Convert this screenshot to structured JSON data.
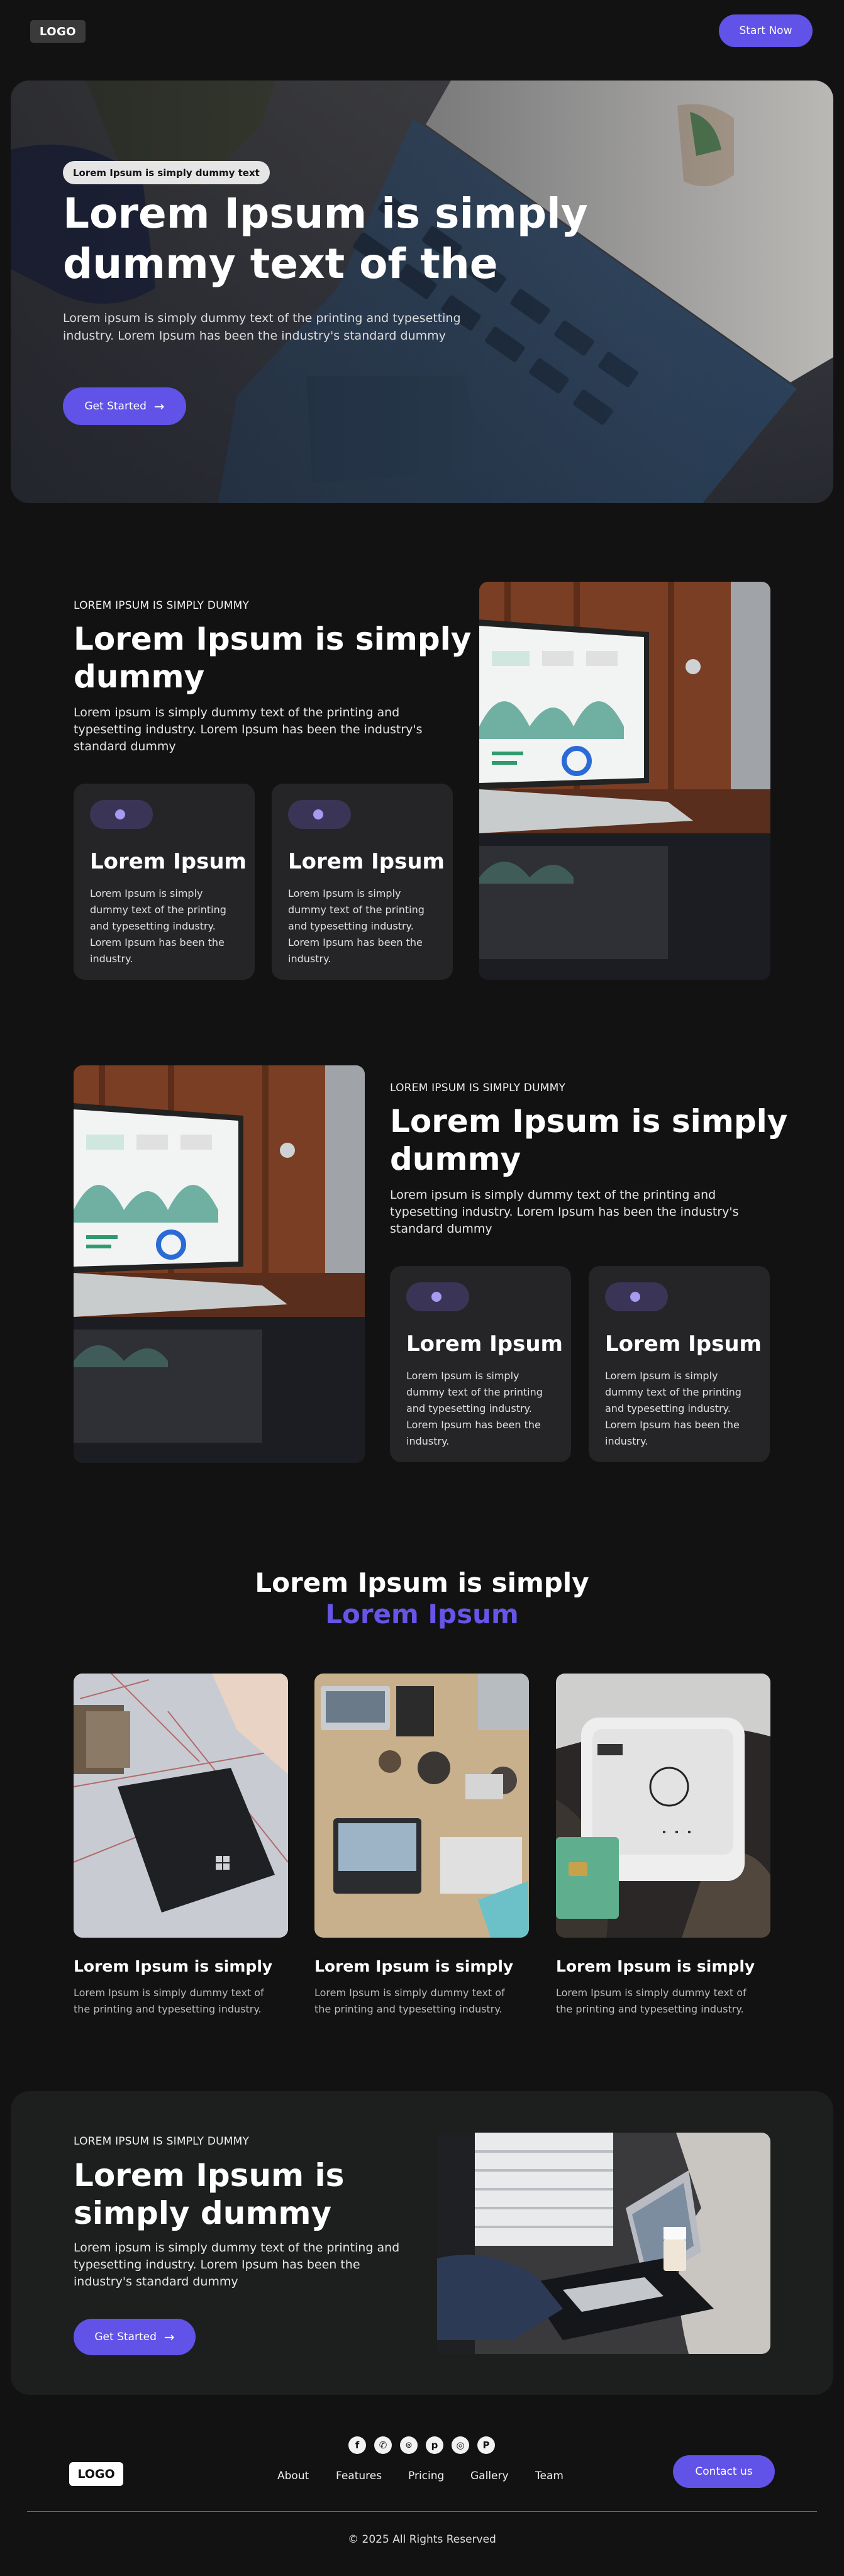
{
  "header": {
    "logo": "LOGO",
    "start_now": "Start Now"
  },
  "hero": {
    "badge": "Lorem Ipsum is simply dummy text",
    "title": "Lorem Ipsum is simply dummy text of the",
    "text": "Lorem ipsum is simply dummy text of the printing and typesetting industry. Lorem Ipsum has been the industry's standard dummy",
    "button": "Get Started",
    "arrow": "→"
  },
  "section1": {
    "eyebrow": "LOREM IPSUM IS SIMPLY DUMMY",
    "title": "Lorem Ipsum is simply dummy",
    "text": "Lorem ipsum is simply dummy text of the printing and typesetting industry. Lorem Ipsum has been the industry's standard dummy",
    "cards": [
      {
        "title": "Lorem Ipsum",
        "text": "Lorem Ipsum is simply dummy text of the printing and typesetting industry. Lorem Ipsum has been the industry."
      },
      {
        "title": "Lorem Ipsum",
        "text": "Lorem Ipsum is simply dummy text of the printing and typesetting industry. Lorem Ipsum has been the industry."
      }
    ]
  },
  "section2": {
    "eyebrow": "LOREM IPSUM IS SIMPLY DUMMY",
    "title": "Lorem Ipsum is simply dummy",
    "text": "Lorem ipsum is simply dummy text of the printing and typesetting industry. Lorem Ipsum has been the industry's standard dummy",
    "cards": [
      {
        "title": "Lorem Ipsum",
        "text": "Lorem Ipsum is simply dummy text of the printing and typesetting industry. Lorem Ipsum has been the industry."
      },
      {
        "title": "Lorem Ipsum",
        "text": "Lorem Ipsum is simply dummy text of the printing and typesetting industry. Lorem Ipsum has been the industry."
      }
    ]
  },
  "gallery": {
    "title_line1": "Lorem Ipsum is simply",
    "title_line2": "Lorem Ipsum",
    "items": [
      {
        "title": "Lorem Ipsum is simply",
        "text": "Lorem Ipsum is simply dummy text of the printing and typesetting industry."
      },
      {
        "title": "Lorem Ipsum is simply",
        "text": "Lorem Ipsum is simply dummy text of the printing and typesetting industry."
      },
      {
        "title": "Lorem Ipsum is simply",
        "text": "Lorem Ipsum is simply dummy text of the printing and typesetting industry."
      }
    ]
  },
  "cta": {
    "eyebrow": "LOREM IPSUM IS SIMPLY DUMMY",
    "title": "Lorem Ipsum is simply dummy",
    "text": "Lorem ipsum is simply dummy text of the printing and typesetting industry. Lorem Ipsum has been the industry's standard dummy",
    "button": "Get Started",
    "arrow": "→"
  },
  "footer": {
    "logo": "LOGO",
    "social_icons": [
      "facebook-icon",
      "whatsapp-icon",
      "github-icon",
      "pinterest-icon",
      "instagram-icon",
      "pinterest-alt-icon"
    ],
    "nav": [
      "About",
      "Features",
      "Pricing",
      "Gallery",
      "Team"
    ],
    "contact": "Contact us",
    "copyright": "© 2025 All Rights Reserved"
  },
  "colors": {
    "background": "#121212",
    "accent": "#6152e8",
    "card": "#252527"
  }
}
